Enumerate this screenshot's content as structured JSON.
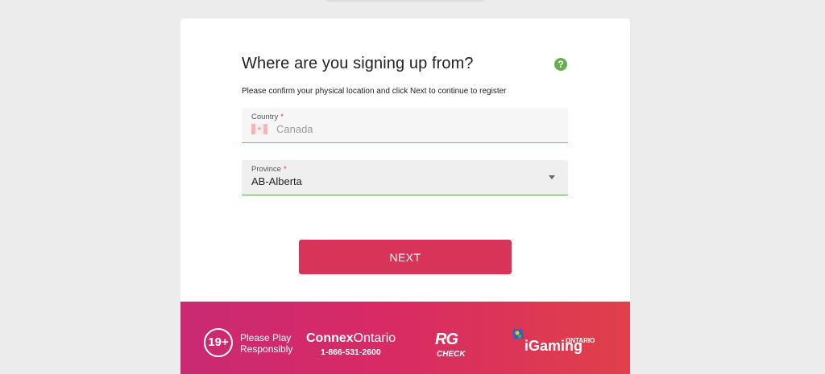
{
  "form": {
    "title": "Where are you signing up from?",
    "subtitle": "Please confirm your physical location and click Next to continue to register",
    "help_icon_glyph": "?",
    "country": {
      "label": "Country",
      "required_mark": "*",
      "value": "Canada",
      "flag_icon": "canada-flag-icon",
      "flag_glyph": "✦"
    },
    "province": {
      "label": "Province",
      "required_mark": "*",
      "value": "AB-Alberta"
    },
    "next_label": "NEXT"
  },
  "footer": {
    "age_badge": "19+",
    "please_play_line1": "Please Play",
    "please_play_line2": "Responsibly",
    "connex_bold": "Connex",
    "connex_thin": "Ontario",
    "connex_phone": "1-866-531-2600",
    "rg_logo": "RG",
    "rg_check": "CHECK",
    "igaming_region": "ONTARIO",
    "igaming_name": "iGaming"
  },
  "colors": {
    "accent_green": "#66b04d",
    "button": "#d83358",
    "footer_start": "#c92a73",
    "footer_end": "#e0404a"
  }
}
